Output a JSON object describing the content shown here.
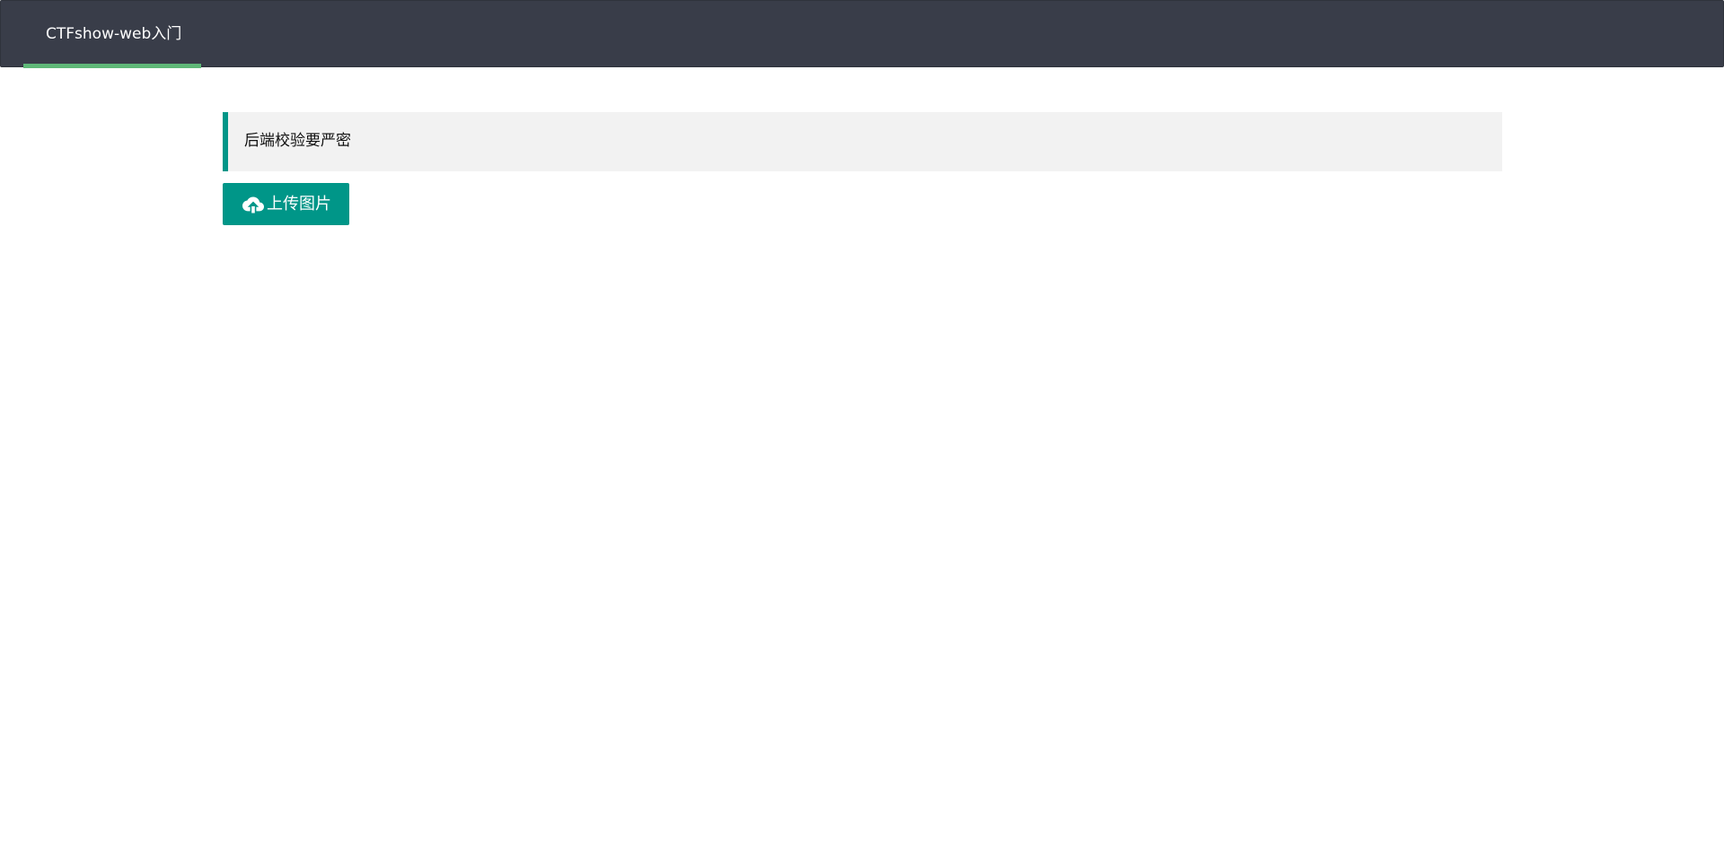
{
  "header": {
    "nav_items": [
      {
        "label": "CTFshow-web入门",
        "active": true
      }
    ]
  },
  "notice": {
    "text": "后端校验要严密"
  },
  "upload": {
    "label": "上传图片",
    "icon": "cloud-upload-icon"
  },
  "colors": {
    "header_bg": "#393d49",
    "active_underline": "#5fb878",
    "accent": "#009688",
    "notice_bg": "#f2f2f2"
  }
}
